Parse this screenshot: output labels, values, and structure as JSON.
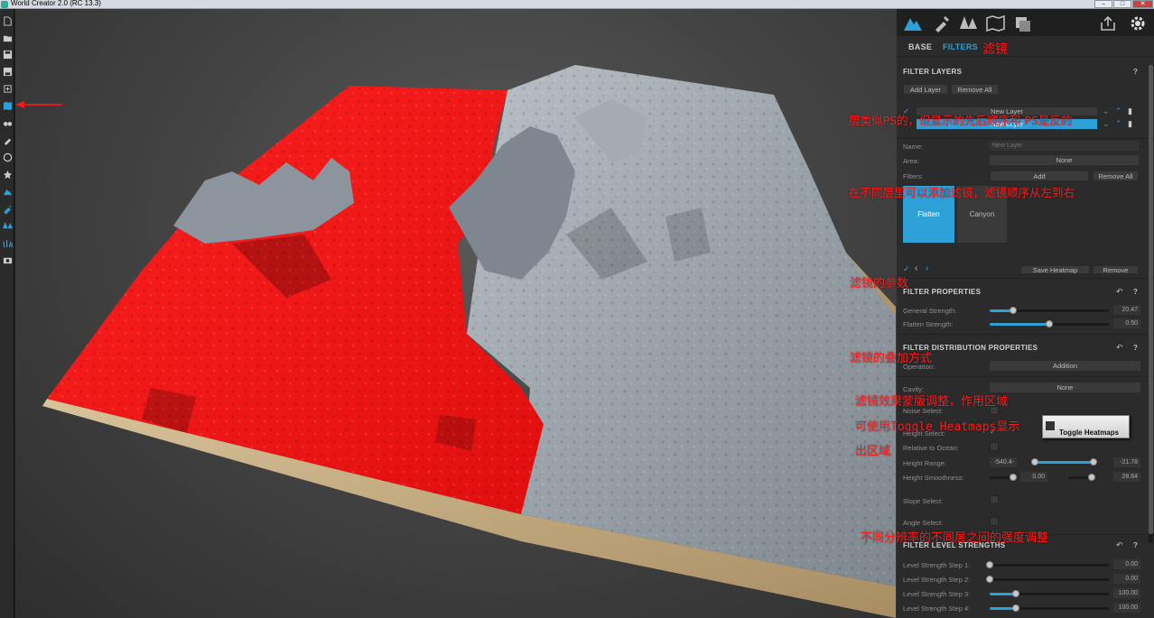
{
  "window": {
    "title": "World Creator 2.0 (RC 13.3)",
    "minimize": "‒",
    "maximize": "□",
    "close": "✕"
  },
  "toolbar": {
    "icons": [
      "new-file-icon",
      "open-folder-icon",
      "save-icon",
      "save-as-icon",
      "export-icon",
      "world-map-icon",
      "binoculars-icon",
      "brush-icon",
      "sphere-icon",
      "gear-star-icon",
      "mountain-icon",
      "pipette-icon",
      "trees-icon",
      "grass-icon",
      "camera-icon"
    ]
  },
  "panel": {
    "tabs": [
      "terrain-icon",
      "pipette-icon",
      "trees-icon",
      "map-icon",
      "layers-icon"
    ],
    "subtabs": {
      "base": "BASE",
      "filters": "FILTERS"
    },
    "filter_layers": {
      "title": "FILTER LAYERS",
      "help": "?",
      "add_layer": "Add Layer",
      "remove_all": "Remove All",
      "layers": [
        {
          "name": "New Layer"
        },
        {
          "name": "New Layer",
          "selected": true
        }
      ]
    },
    "layer_props": {
      "name_label": "Name:",
      "name_placeholder": "New Layer",
      "area_label": "Area:",
      "area_value": "None",
      "filters_label": "Filters:",
      "add": "Add",
      "remove_all": "Remove All"
    },
    "filter_cards": [
      {
        "name": "Flatten",
        "active": true
      },
      {
        "name": "Canyon",
        "active": false
      }
    ],
    "card_controls": {
      "check": "✓",
      "prev": "‹",
      "next": "›",
      "save_heatmap": "Save Heatmap",
      "remove": "Remove"
    },
    "filter_properties": {
      "title": "FILTER PROPERTIES",
      "help": "?",
      "rows": [
        {
          "label": "General Strength:",
          "value": "20.47",
          "fraction": 0.2
        },
        {
          "label": "Flatten Strength:",
          "value": "0.50",
          "fraction": 0.5
        }
      ]
    },
    "distribution": {
      "title": "FILTER DISTRIBUTION PROPERTIES",
      "help": "?",
      "operation_label": "Operation:",
      "operation_value": "Addition",
      "cavity_label": "Cavity:",
      "cavity_value": "None",
      "noise_label": "Noise Select:",
      "height_label": "Height Select:",
      "relative_label": "Relative to Ocean:",
      "height_range_label": "Height Range:",
      "height_range_min": "-540.4-",
      "height_range_max": "-21.78",
      "height_smooth_label": "Height Smoothness:",
      "height_smooth_a": "0.00",
      "height_smooth_b": "28.64",
      "slope_label": "Slope Select:",
      "angle_label": "Angle Select:",
      "tooltip": "Toggle Heatmaps"
    },
    "level_strengths": {
      "title": "FILTER LEVEL STRENGTHS",
      "help": "?",
      "rows": [
        {
          "label": "Level Strength Step 1:",
          "value": "0.00",
          "fraction": 0.0
        },
        {
          "label": "Level Strength Step 2:",
          "value": "0.00",
          "fraction": 0.0
        },
        {
          "label": "Level Strength Step 3:",
          "value": "100.00",
          "fraction": 0.22
        },
        {
          "label": "Level Strength Step 4:",
          "value": "100.00",
          "fraction": 0.22
        }
      ]
    }
  },
  "annotations": {
    "filters_label": "滤镜",
    "layers_note": "层类似PS的，但显示的先后顺序和 PS是反的",
    "filters_note": "在不同层里可以添加滤镜，滤镜顺序从左到右",
    "params_note": "滤镜的参数",
    "blend_note": "滤镜的叠加方式",
    "mask_note": "滤镜效果蒙版调整，作用区域",
    "toggle_note": "可使用Toggle Heatmaps显示",
    "area_note": "出区域",
    "levels_note": "不同分辨率的不同层之间的强度调整"
  },
  "colors": {
    "accent": "#2ea0d8",
    "annotation": "#ff1a1a",
    "heatmap": "#ff1a1a",
    "terrain": "#9aa3ab"
  }
}
